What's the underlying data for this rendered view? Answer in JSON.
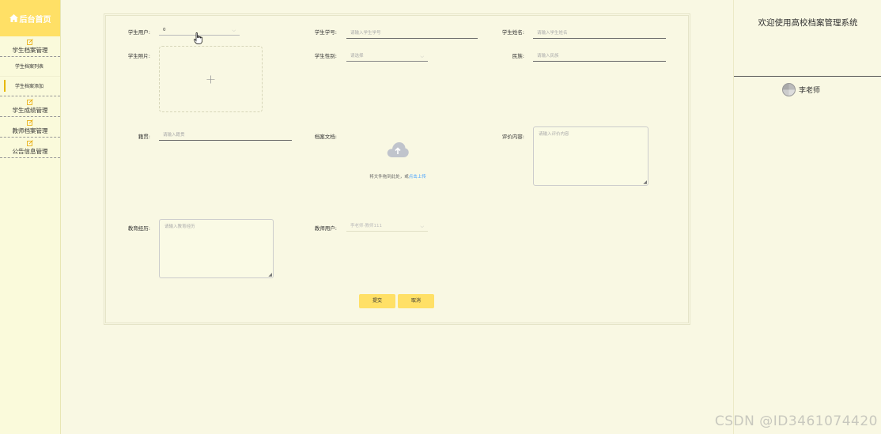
{
  "sidebar": {
    "home_label": "后台首页",
    "groups": [
      {
        "label": "学生档案管理",
        "items": [
          "学生档案列表",
          "学生档案添加"
        ]
      },
      {
        "label": "学生成绩管理"
      },
      {
        "label": "教师档案管理"
      },
      {
        "label": "公告信息管理"
      }
    ]
  },
  "form": {
    "student_user": {
      "label": "学生用户:",
      "value": "0"
    },
    "student_no": {
      "label": "学生学号:",
      "placeholder": "请输入学生学号"
    },
    "student_name": {
      "label": "学生姓名:",
      "placeholder": "请输入学生姓名"
    },
    "student_photo": {
      "label": "学生照片:"
    },
    "student_gender": {
      "label": "学生性别:",
      "placeholder": "请选择"
    },
    "ethnicity": {
      "label": "民族:",
      "placeholder": "请输入民族"
    },
    "native_place": {
      "label": "籍贯:",
      "placeholder": "请输入籍贯"
    },
    "archive_doc": {
      "label": "档案文档:",
      "drag_text": "将文件拖到此处，或",
      "upload_link": "点击上传"
    },
    "evaluation": {
      "label": "评价内容:",
      "placeholder": "请输入评价内容"
    },
    "education": {
      "label": "教育经历:",
      "placeholder": "请输入教育经历"
    },
    "teacher_user": {
      "label": "教师用户:",
      "value": "李老师-教师111"
    },
    "submit_label": "提交",
    "cancel_label": "取消"
  },
  "header": {
    "welcome": "欢迎使用高校档案管理系统",
    "username": "李老师"
  },
  "watermark": "CSDN @ID3461074420",
  "colors": {
    "accent": "#ffe066",
    "background": "#f9f8e3",
    "link": "#409eff"
  }
}
